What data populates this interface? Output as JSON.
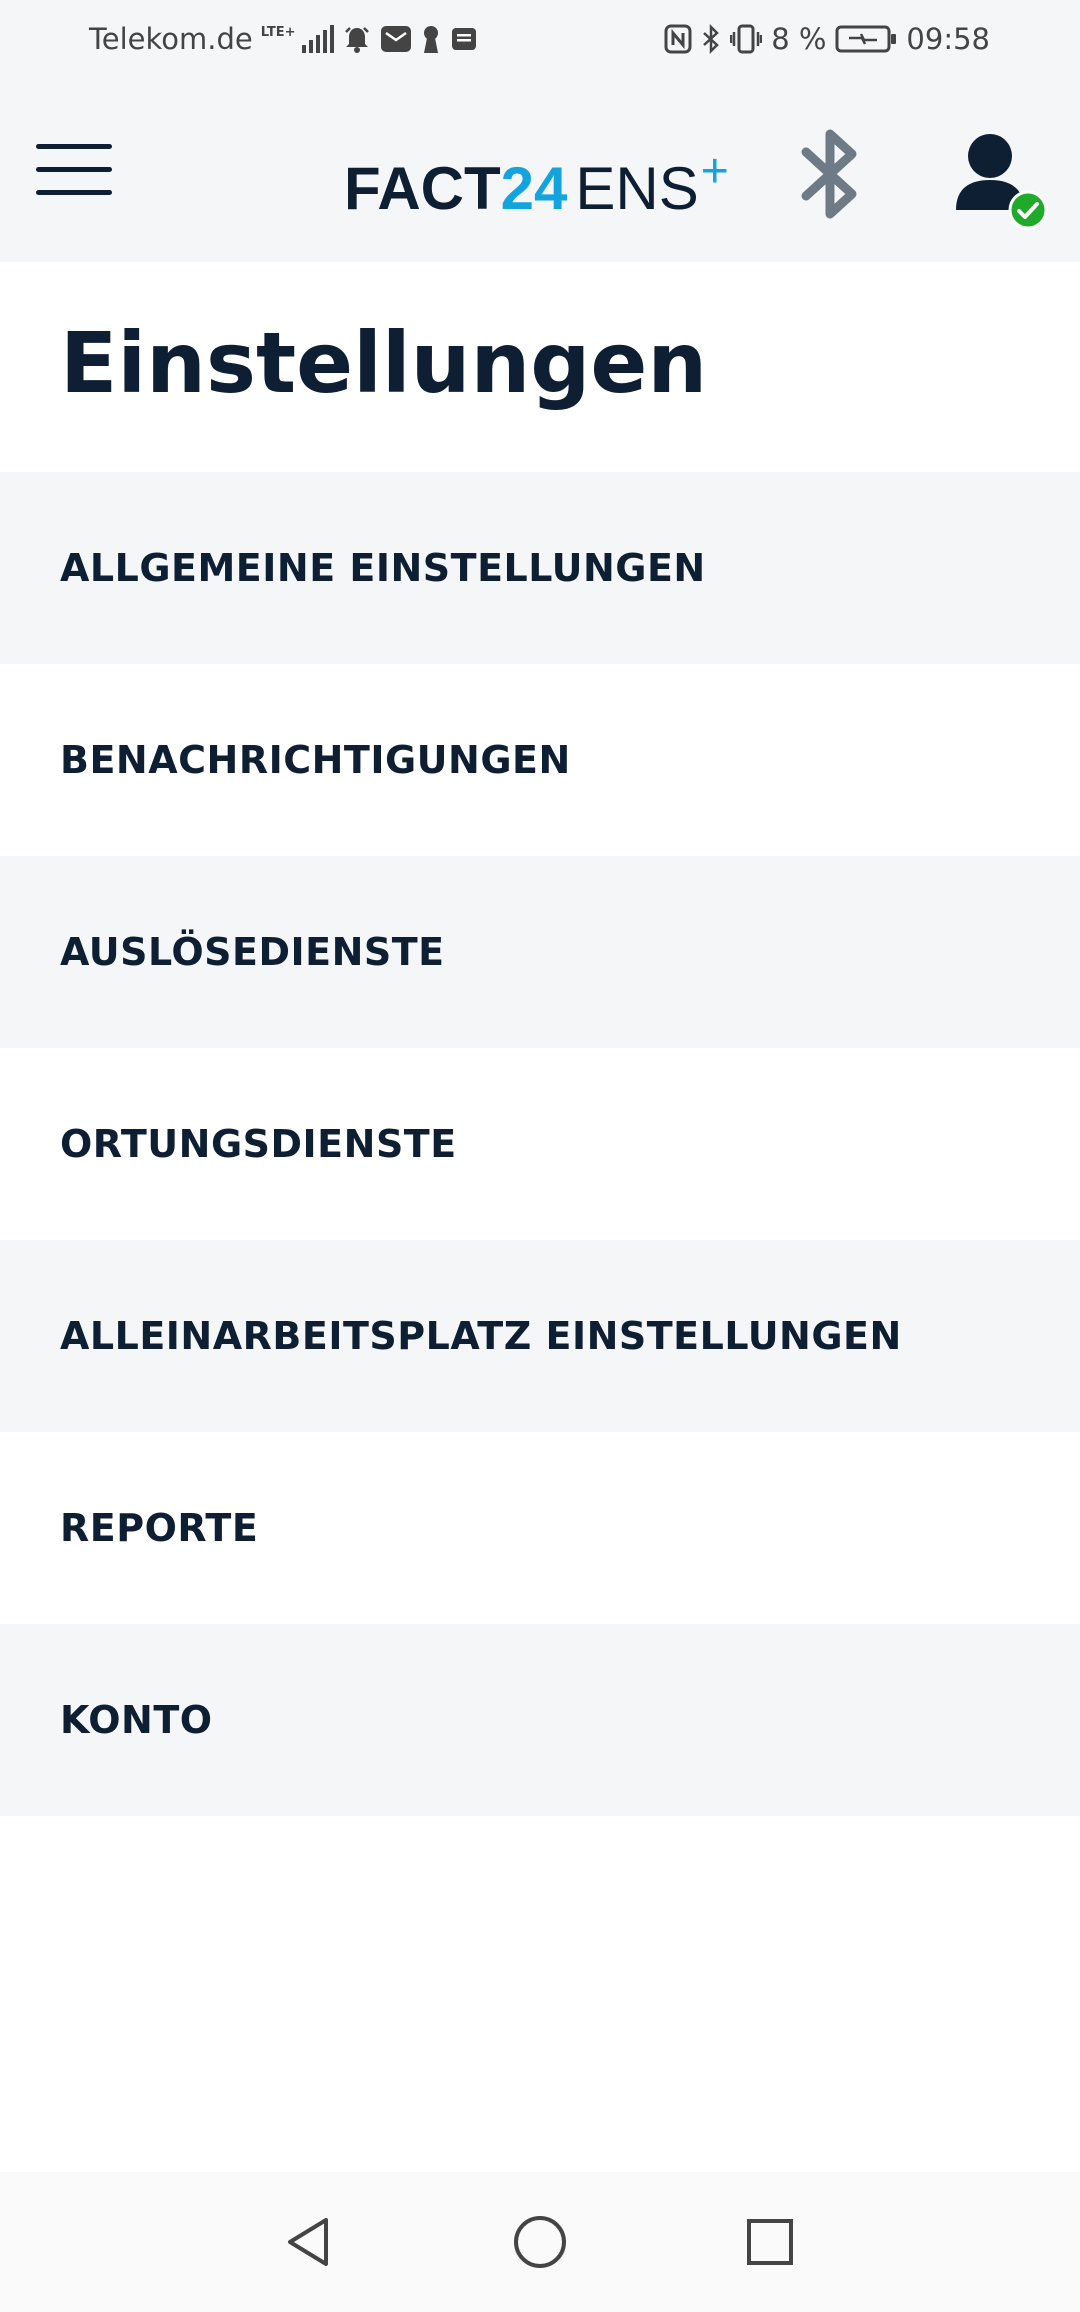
{
  "status_bar": {
    "carrier": "Telekom.de",
    "network": "LTE+",
    "battery": "8 %",
    "time": "09:58",
    "icons": [
      "signal-icon",
      "alarm-icon",
      "huawei-mail-icon",
      "keyhole-icon",
      "message-icon",
      "nfc-icon",
      "bluetooth-icon",
      "vibrate-icon",
      "battery-charging-icon"
    ]
  },
  "header": {
    "logo": {
      "part1": "FACT",
      "part2": "24",
      "part3": "ENS",
      "part4": "+"
    },
    "menu_icon": "hamburger-menu-icon",
    "bluetooth_icon": "bluetooth-icon",
    "user_icon": "user-icon",
    "user_status_icon": "check-circle-icon",
    "colors": {
      "brand_dark": "#0f1f33",
      "brand_blue": "#13a4dd",
      "status_green": "#1faa2a",
      "bluetooth_gray": "#6e7a86"
    }
  },
  "page": {
    "title": "Einstellungen"
  },
  "settings": {
    "items": [
      {
        "label": "ALLGEMEINE EINSTELLUNGEN"
      },
      {
        "label": "BENACHRICHTIGUNGEN"
      },
      {
        "label": "AUSLÖSEDIENSTE"
      },
      {
        "label": "ORTUNGSDIENSTE"
      },
      {
        "label": "ALLEINARBEITSPLATZ EINSTELLUNGEN"
      },
      {
        "label": "REPORTE"
      },
      {
        "label": "KONTO"
      }
    ]
  },
  "navbar": {
    "icons": [
      "back-icon",
      "home-icon",
      "recents-icon"
    ]
  }
}
